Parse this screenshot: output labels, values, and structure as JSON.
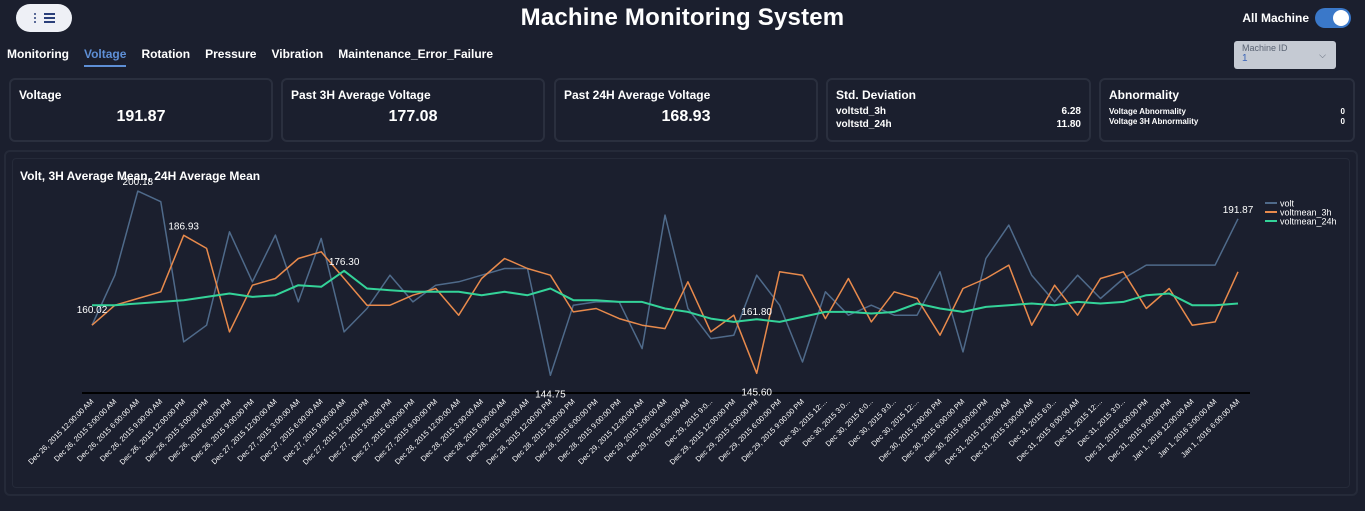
{
  "header": {
    "title": "Machine Monitoring System",
    "toggle_label": "All Machine",
    "toggle_on": true
  },
  "tabs": [
    {
      "label": "Monitoring"
    },
    {
      "label": "Voltage",
      "active": true
    },
    {
      "label": "Rotation"
    },
    {
      "label": "Pressure"
    },
    {
      "label": "Vibration"
    },
    {
      "label": "Maintenance_Error_Failure"
    }
  ],
  "machine_select": {
    "label": "Machine ID",
    "value": "1"
  },
  "cards": {
    "voltage": {
      "title": "Voltage",
      "value": "191.87"
    },
    "avg3h": {
      "title": "Past 3H Average Voltage",
      "value": "177.08"
    },
    "avg24h": {
      "title": "Past 24H Average Voltage",
      "value": "168.93"
    },
    "std": {
      "title": "Std. Deviation",
      "rows": [
        {
          "label": "voltstd_3h",
          "value": "6.28"
        },
        {
          "label": "voltstd_24h",
          "value": "11.80"
        }
      ]
    },
    "abn": {
      "title": "Abnormality",
      "rows": [
        {
          "label": "Voltage Abnormality",
          "value": "0"
        },
        {
          "label": "Voltage 3H Abnormality",
          "value": "0"
        }
      ]
    }
  },
  "colors": {
    "volt": "#4f6a8a",
    "voltmean_3h": "#e88a4c",
    "voltmean_24h": "#34d399",
    "accent": "#5e8fd6"
  },
  "chart_data": {
    "type": "line",
    "title": "Volt, 3H Average Mean, 24H Average Mean",
    "legend_position": "top-right",
    "x": [
      "Dec 26, 2015 12:00:00 AM",
      "Dec 26, 2015 3:00:00 AM",
      "Dec 26, 2015 6:00:00 AM",
      "Dec 26, 2015 9:00:00 AM",
      "Dec 26, 2015 12:00:00 PM",
      "Dec 26, 2015 3:00:00 PM",
      "Dec 26, 2015 6:00:00 PM",
      "Dec 26, 2015 9:00:00 PM",
      "Dec 27, 2015 12:00:00 AM",
      "Dec 27, 2015 3:00:00 AM",
      "Dec 27, 2015 6:00:00 AM",
      "Dec 27, 2015 9:00:00 AM",
      "Dec 27, 2015 12:00:00 PM",
      "Dec 27, 2015 3:00:00 PM",
      "Dec 27, 2015 6:00:00 PM",
      "Dec 27, 2015 9:00:00 PM",
      "Dec 28, 2015 12:00:00 AM",
      "Dec 28, 2015 3:00:00 AM",
      "Dec 28, 2015 6:00:00 AM",
      "Dec 28, 2015 9:00:00 AM",
      "Dec 28, 2015 12:00:00 PM",
      "Dec 28, 2015 3:00:00 PM",
      "Dec 28, 2015 6:00:00 PM",
      "Dec 28, 2015 9:00:00 PM",
      "Dec 29, 2015 12:00:00 AM",
      "Dec 29, 2015 3:00:00 AM",
      "Dec 29, 2015 6:00:00 AM",
      "Dec 29, 2015 9:0...",
      "Dec 29, 2015 12:00:00 PM",
      "Dec 29, 2015 3:00:00 PM",
      "Dec 29, 2015 6:00:00 PM",
      "Dec 29, 2015 9:00:00 PM",
      "Dec 30, 2015 12:...",
      "Dec 30, 2015 3:0...",
      "Dec 30, 2015 6:0...",
      "Dec 30, 2015 9:0...",
      "Dec 30, 2015 12:...",
      "Dec 30, 2015 3:00:00 PM",
      "Dec 30, 2015 6:00:00 PM",
      "Dec 30, 2015 9:00:00 PM",
      "Dec 31, 2015 12:00:00 AM",
      "Dec 31, 2015 3:00:00 AM",
      "Dec 31, 2015 6:0...",
      "Dec 31, 2015 9:00:00 AM",
      "Dec 31, 2015 12:...",
      "Dec 31, 2015 3:0...",
      "Dec 31, 2015 6:00:00 PM",
      "Dec 31, 2015 9:00:00 PM",
      "Jan 1, 2016 12:00:00 AM",
      "Jan 1, 2016 3:00:00 AM",
      "Jan 1, 2016 6:00:00 AM"
    ],
    "series": [
      {
        "name": "volt",
        "values": [
          160.02,
          175,
          200.18,
          197,
          155,
          160,
          188,
          173,
          187,
          167,
          186,
          158,
          165,
          175,
          167,
          172,
          173,
          175,
          177,
          177,
          145,
          166,
          167,
          167,
          153,
          193,
          165,
          156,
          157,
          175,
          166,
          149,
          170,
          163,
          166,
          163,
          163,
          176,
          152,
          180,
          190,
          175,
          167,
          175,
          168,
          174,
          178,
          178,
          178,
          178,
          191.87
        ]
      },
      {
        "name": "voltmean_3h",
        "values": [
          160.02,
          166,
          168,
          170,
          186.93,
          183,
          158,
          172,
          174,
          180,
          182,
          174,
          166,
          166,
          169,
          171,
          163,
          174,
          180,
          177,
          175,
          164,
          165,
          162,
          160,
          159,
          173,
          158,
          163,
          145.6,
          176,
          175,
          162,
          174,
          161,
          170,
          168,
          157,
          171,
          174,
          178,
          160,
          172,
          163,
          174,
          176,
          165,
          171,
          160,
          161,
          176
        ]
      },
      {
        "name": "voltmean_24h",
        "values": [
          166,
          166,
          166.5,
          167,
          167.5,
          168.5,
          169.5,
          168.5,
          169,
          172,
          171.5,
          176.3,
          171,
          170.5,
          170,
          170,
          170,
          169,
          170,
          169,
          171,
          167.5,
          167.5,
          167,
          167,
          165,
          164,
          162,
          161,
          161.8,
          161,
          162.5,
          164,
          164,
          163.5,
          164,
          166.5,
          165,
          164,
          165.5,
          166,
          166.5,
          166,
          167,
          166.5,
          167,
          169,
          169.5,
          166,
          166,
          166.5
        ]
      }
    ],
    "annotations": [
      {
        "series": "volt",
        "index": 0,
        "label": "160.02"
      },
      {
        "series": "volt",
        "index": 2,
        "label": "200.18"
      },
      {
        "series": "voltmean_3h",
        "index": 4,
        "label": "186.93"
      },
      {
        "series": "voltmean_24h",
        "index": 11,
        "label": "176.30"
      },
      {
        "series": "volt",
        "index": 20,
        "label": "144.75"
      },
      {
        "series": "voltmean_3h",
        "index": 29,
        "label": "145.60"
      },
      {
        "series": "voltmean_24h",
        "index": 29,
        "label": "161.80"
      },
      {
        "series": "volt",
        "index": 50,
        "label": "191.87"
      }
    ],
    "ylim": [
      140,
      205
    ],
    "grid": false
  }
}
